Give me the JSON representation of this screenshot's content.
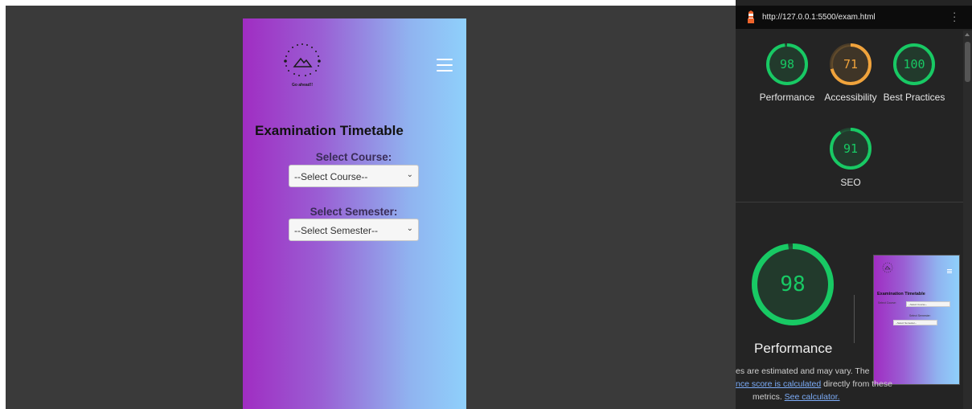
{
  "phone": {
    "logo_caption": "Go ahead!!",
    "title": "Examination Timetable",
    "course_label": "Select Course:",
    "course_value": "--Select Course--",
    "semester_label": "Select Semester:",
    "semester_value": "--Select Semester--"
  },
  "devtools": {
    "url": "http://127.0.0.1:5500/exam.html",
    "scores": [
      {
        "name": "Performance",
        "value": 98,
        "color": "#18c964"
      },
      {
        "name": "Accessibility",
        "value": 71,
        "color": "#f0a33c"
      },
      {
        "name": "Best Practices",
        "value": 100,
        "color": "#18c964"
      },
      {
        "name": "SEO",
        "value": 91,
        "color": "#18c964"
      }
    ],
    "big_score": {
      "name": "Performance",
      "value": 98,
      "color": "#18c964"
    },
    "note": {
      "line1": "es are estimated and may vary. The",
      "link1": "nce score is calculated",
      "line2_rest": " directly from these",
      "line3_pre": "metrics. ",
      "link2": "See calculator."
    },
    "thumbnail": {
      "title": "Examination Timetable",
      "course_label": "Select Course:",
      "course_value": "--Select Course--",
      "semester_label": "Select Semester:",
      "semester_value": "--Select Semester--"
    }
  },
  "icons": {
    "hamburger": "menu-icon",
    "lighthouse": "lighthouse-icon",
    "kebab": "more-vertical-icon",
    "chevron": "chevron-down-icon"
  }
}
